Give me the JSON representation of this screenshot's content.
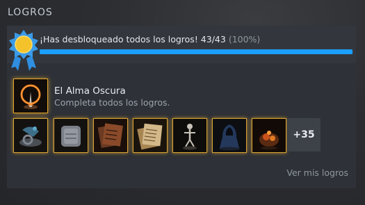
{
  "section_title": "LOGROS",
  "progress": {
    "message": "¡Has desbloqueado todos los logros! 43/43",
    "percent_label": "(100%)",
    "fraction": 1.0
  },
  "featured": {
    "name": "El Alma Oscura",
    "description": "Completa todos los logros.",
    "icon": "bonfire-icon"
  },
  "thumbnails": [
    {
      "icon": "ring-and-ashes-icon"
    },
    {
      "icon": "grey-stone-icon"
    },
    {
      "icon": "scroll-stack-icon"
    },
    {
      "icon": "parchment-stack-icon"
    },
    {
      "icon": "skeleton-icon"
    },
    {
      "icon": "hooded-figure-icon"
    },
    {
      "icon": "ember-creature-icon"
    }
  ],
  "more_count_label": "+35",
  "view_link_label": "Ver mis logros",
  "colors": {
    "accent_blue": "#1a9fff",
    "gold_border": "#d9a534"
  }
}
